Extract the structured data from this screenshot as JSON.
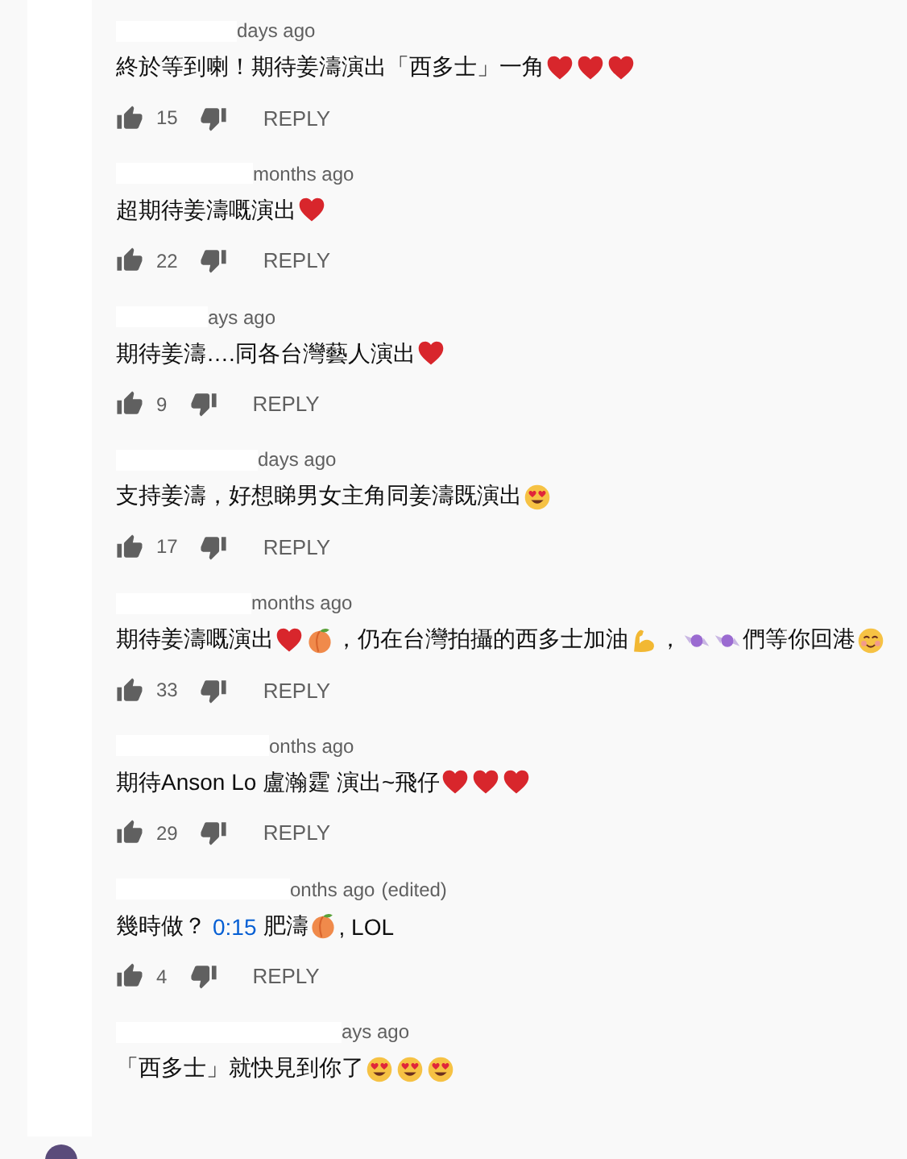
{
  "comments": [
    {
      "time": "days ago",
      "body": [
        {
          "kind": "text",
          "text": "終於等到喇！期待姜濤演出「西多士」一角"
        },
        {
          "kind": "heart"
        },
        {
          "kind": "heart"
        },
        {
          "kind": "heart"
        }
      ],
      "likes": "15",
      "reply": "REPLY"
    },
    {
      "time": "months ago",
      "body": [
        {
          "kind": "text",
          "text": "超期待姜濤嘅演出"
        },
        {
          "kind": "heart"
        }
      ],
      "likes": "22",
      "reply": "REPLY"
    },
    {
      "time": "ays ago",
      "body": [
        {
          "kind": "text",
          "text": "期待姜濤….同各台灣藝人演出"
        },
        {
          "kind": "heart"
        }
      ],
      "likes": "9",
      "reply": "REPLY"
    },
    {
      "time": "days ago",
      "body": [
        {
          "kind": "text",
          "text": "支持姜濤，好想睇男女主角同姜濤既演出"
        },
        {
          "kind": "heart-eyes"
        }
      ],
      "likes": "17",
      "reply": "REPLY"
    },
    {
      "time": "months ago",
      "body": [
        {
          "kind": "text",
          "text": "期待姜濤嘅演出"
        },
        {
          "kind": "heart"
        },
        {
          "kind": "peach"
        },
        {
          "kind": "text",
          "text": "，仍在台灣拍攝的西多士加油"
        },
        {
          "kind": "muscle"
        },
        {
          "kind": "text",
          "text": "，"
        },
        {
          "kind": "candy"
        },
        {
          "kind": "candy"
        },
        {
          "kind": "text",
          "text": "們等你回港"
        },
        {
          "kind": "smiling-hearts"
        }
      ],
      "likes": "33",
      "reply": "REPLY"
    },
    {
      "time": "onths ago",
      "body": [
        {
          "kind": "text",
          "text": "期待Anson Lo 盧瀚霆 演出~飛仔"
        },
        {
          "kind": "heart"
        },
        {
          "kind": "heart"
        },
        {
          "kind": "heart"
        }
      ],
      "likes": "29",
      "reply": "REPLY"
    },
    {
      "time": "onths ago",
      "edited_label": "(edited)",
      "body": [
        {
          "kind": "text",
          "text": "幾時做？"
        },
        {
          "kind": "link",
          "text": "0:15"
        },
        {
          "kind": "text",
          "text": "肥濤"
        },
        {
          "kind": "peach"
        },
        {
          "kind": "text",
          "text": ", LOL"
        }
      ],
      "likes": "4",
      "reply": "REPLY"
    },
    {
      "time": "ays ago",
      "body": [
        {
          "kind": "text",
          "text": "「西多士」就快見到你了"
        },
        {
          "kind": "heart-eyes"
        },
        {
          "kind": "heart-eyes"
        },
        {
          "kind": "heart-eyes"
        }
      ]
    }
  ]
}
